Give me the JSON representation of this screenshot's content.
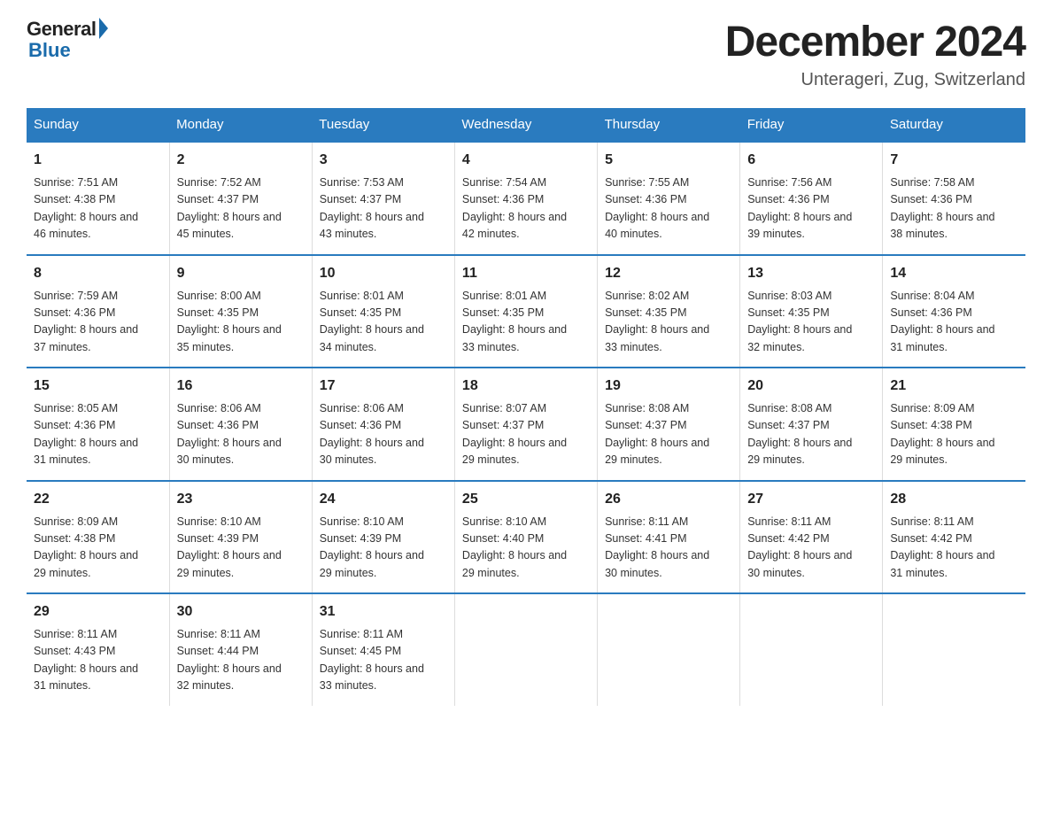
{
  "logo": {
    "general": "General",
    "blue": "Blue"
  },
  "title": "December 2024",
  "subtitle": "Unterageri, Zug, Switzerland",
  "days_of_week": [
    "Sunday",
    "Monday",
    "Tuesday",
    "Wednesday",
    "Thursday",
    "Friday",
    "Saturday"
  ],
  "weeks": [
    [
      {
        "day": "1",
        "sunrise": "7:51 AM",
        "sunset": "4:38 PM",
        "daylight": "8 hours and 46 minutes."
      },
      {
        "day": "2",
        "sunrise": "7:52 AM",
        "sunset": "4:37 PM",
        "daylight": "8 hours and 45 minutes."
      },
      {
        "day": "3",
        "sunrise": "7:53 AM",
        "sunset": "4:37 PM",
        "daylight": "8 hours and 43 minutes."
      },
      {
        "day": "4",
        "sunrise": "7:54 AM",
        "sunset": "4:36 PM",
        "daylight": "8 hours and 42 minutes."
      },
      {
        "day": "5",
        "sunrise": "7:55 AM",
        "sunset": "4:36 PM",
        "daylight": "8 hours and 40 minutes."
      },
      {
        "day": "6",
        "sunrise": "7:56 AM",
        "sunset": "4:36 PM",
        "daylight": "8 hours and 39 minutes."
      },
      {
        "day": "7",
        "sunrise": "7:58 AM",
        "sunset": "4:36 PM",
        "daylight": "8 hours and 38 minutes."
      }
    ],
    [
      {
        "day": "8",
        "sunrise": "7:59 AM",
        "sunset": "4:36 PM",
        "daylight": "8 hours and 37 minutes."
      },
      {
        "day": "9",
        "sunrise": "8:00 AM",
        "sunset": "4:35 PM",
        "daylight": "8 hours and 35 minutes."
      },
      {
        "day": "10",
        "sunrise": "8:01 AM",
        "sunset": "4:35 PM",
        "daylight": "8 hours and 34 minutes."
      },
      {
        "day": "11",
        "sunrise": "8:01 AM",
        "sunset": "4:35 PM",
        "daylight": "8 hours and 33 minutes."
      },
      {
        "day": "12",
        "sunrise": "8:02 AM",
        "sunset": "4:35 PM",
        "daylight": "8 hours and 33 minutes."
      },
      {
        "day": "13",
        "sunrise": "8:03 AM",
        "sunset": "4:35 PM",
        "daylight": "8 hours and 32 minutes."
      },
      {
        "day": "14",
        "sunrise": "8:04 AM",
        "sunset": "4:36 PM",
        "daylight": "8 hours and 31 minutes."
      }
    ],
    [
      {
        "day": "15",
        "sunrise": "8:05 AM",
        "sunset": "4:36 PM",
        "daylight": "8 hours and 31 minutes."
      },
      {
        "day": "16",
        "sunrise": "8:06 AM",
        "sunset": "4:36 PM",
        "daylight": "8 hours and 30 minutes."
      },
      {
        "day": "17",
        "sunrise": "8:06 AM",
        "sunset": "4:36 PM",
        "daylight": "8 hours and 30 minutes."
      },
      {
        "day": "18",
        "sunrise": "8:07 AM",
        "sunset": "4:37 PM",
        "daylight": "8 hours and 29 minutes."
      },
      {
        "day": "19",
        "sunrise": "8:08 AM",
        "sunset": "4:37 PM",
        "daylight": "8 hours and 29 minutes."
      },
      {
        "day": "20",
        "sunrise": "8:08 AM",
        "sunset": "4:37 PM",
        "daylight": "8 hours and 29 minutes."
      },
      {
        "day": "21",
        "sunrise": "8:09 AM",
        "sunset": "4:38 PM",
        "daylight": "8 hours and 29 minutes."
      }
    ],
    [
      {
        "day": "22",
        "sunrise": "8:09 AM",
        "sunset": "4:38 PM",
        "daylight": "8 hours and 29 minutes."
      },
      {
        "day": "23",
        "sunrise": "8:10 AM",
        "sunset": "4:39 PM",
        "daylight": "8 hours and 29 minutes."
      },
      {
        "day": "24",
        "sunrise": "8:10 AM",
        "sunset": "4:39 PM",
        "daylight": "8 hours and 29 minutes."
      },
      {
        "day": "25",
        "sunrise": "8:10 AM",
        "sunset": "4:40 PM",
        "daylight": "8 hours and 29 minutes."
      },
      {
        "day": "26",
        "sunrise": "8:11 AM",
        "sunset": "4:41 PM",
        "daylight": "8 hours and 30 minutes."
      },
      {
        "day": "27",
        "sunrise": "8:11 AM",
        "sunset": "4:42 PM",
        "daylight": "8 hours and 30 minutes."
      },
      {
        "day": "28",
        "sunrise": "8:11 AM",
        "sunset": "4:42 PM",
        "daylight": "8 hours and 31 minutes."
      }
    ],
    [
      {
        "day": "29",
        "sunrise": "8:11 AM",
        "sunset": "4:43 PM",
        "daylight": "8 hours and 31 minutes."
      },
      {
        "day": "30",
        "sunrise": "8:11 AM",
        "sunset": "4:44 PM",
        "daylight": "8 hours and 32 minutes."
      },
      {
        "day": "31",
        "sunrise": "8:11 AM",
        "sunset": "4:45 PM",
        "daylight": "8 hours and 33 minutes."
      },
      {
        "day": "",
        "sunrise": "",
        "sunset": "",
        "daylight": ""
      },
      {
        "day": "",
        "sunrise": "",
        "sunset": "",
        "daylight": ""
      },
      {
        "day": "",
        "sunrise": "",
        "sunset": "",
        "daylight": ""
      },
      {
        "day": "",
        "sunrise": "",
        "sunset": "",
        "daylight": ""
      }
    ]
  ]
}
